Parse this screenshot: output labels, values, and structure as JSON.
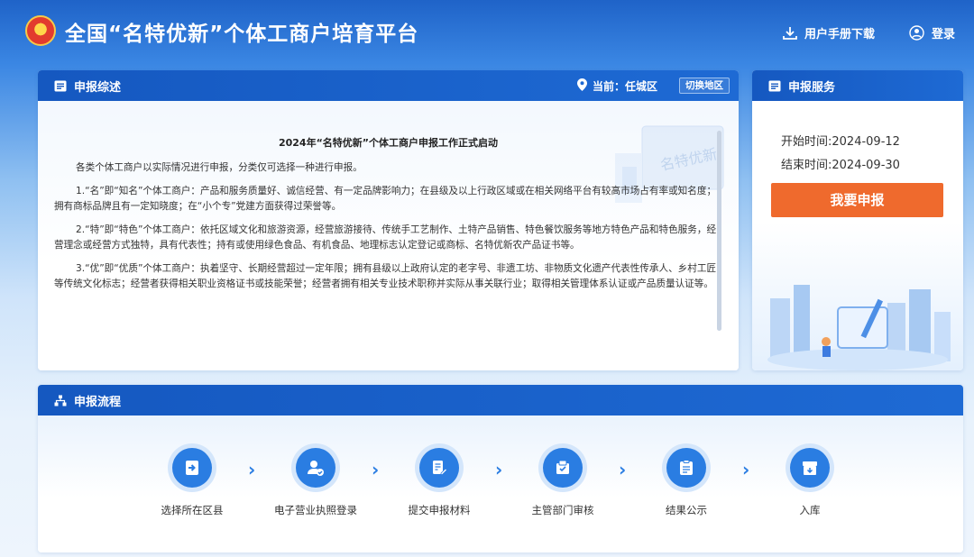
{
  "header": {
    "title": "全国“名特优新”个体工商户培育平台",
    "manual_download": "用户手册下载",
    "login": "登录"
  },
  "summary": {
    "heading": "申报综述",
    "location_label": "当前：任城区",
    "switch_region": "切换地区",
    "notice_title": "2024年“名特优新”个体工商户申报工作正式启动",
    "paragraphs": [
      "各类个体工商户以实际情况进行申报，分类仅可选择一种进行申报。",
      "1.“名”即“知名”个体工商户：产品和服务质量好、诚信经营、有一定品牌影响力；在县级及以上行政区域或在相关网络平台有较高市场占有率或知名度；拥有商标品牌且有一定知晓度；在“小个专”党建方面获得过荣誉等。",
      "2.“特”即“特色”个体工商户：依托区域文化和旅游资源，经营旅游接待、传统手工艺制作、土特产品销售、特色餐饮服务等地方特色产品和特色服务，经营理念或经营方式独特，具有代表性；持有或使用绿色食品、有机食品、地理标志认定登记或商标、名特优新农产品证书等。",
      "3.“优”即“优质”个体工商户：执着坚守、长期经营超过一定年限；拥有县级以上政府认定的老字号、非遗工坊、非物质文化遗产代表性传承人、乡村工匠等传统文化标志；经营者获得相关职业资格证书或技能荣誉；经营者拥有相关专业技术职称并实际从事关联行业；取得相关管理体系认证或产品质量认证等。"
    ],
    "deco_text": "名特优新"
  },
  "service": {
    "heading": "申报服务",
    "start": "开始时间:2024-09-12",
    "end": "结束时间:2024-09-30",
    "apply_button": "我要申报"
  },
  "process": {
    "heading": "申报流程",
    "steps": [
      {
        "label": "选择所在区县",
        "icon": "login-arrow-icon"
      },
      {
        "label": "电子营业执照登录",
        "icon": "user-check-icon"
      },
      {
        "label": "提交申报材料",
        "icon": "document-edit-icon"
      },
      {
        "label": "主管部门审核",
        "icon": "audit-box-icon"
      },
      {
        "label": "结果公示",
        "icon": "notice-board-icon"
      },
      {
        "label": "入库",
        "icon": "archive-box-icon"
      }
    ]
  },
  "colors": {
    "brand_blue": "#1558c0",
    "step_blue": "#2a7de2",
    "apply_orange": "#ef6a2d"
  }
}
